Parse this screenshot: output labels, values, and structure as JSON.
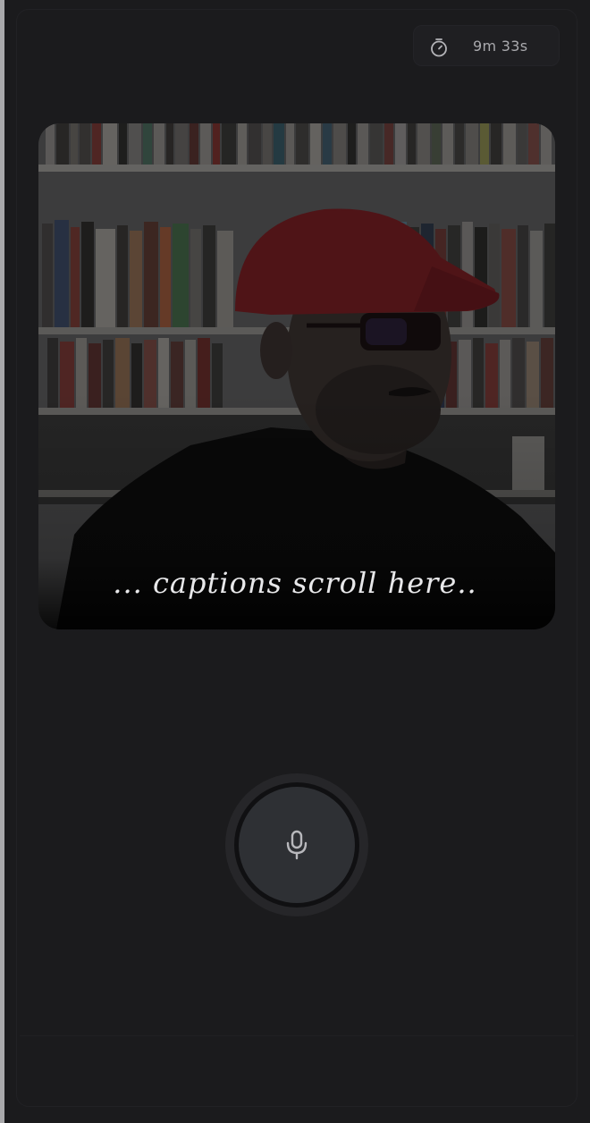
{
  "timer": {
    "icon": "stopwatch-icon",
    "elapsed": "9m 33s"
  },
  "video": {
    "caption": "... captions scroll here.."
  },
  "mic": {
    "icon": "microphone-icon"
  },
  "colors": {
    "background": "#1b1b1d",
    "timer_text": "#a9a9ad",
    "mic_button": "#2e3034",
    "caption_text": "#e8e8ea"
  }
}
